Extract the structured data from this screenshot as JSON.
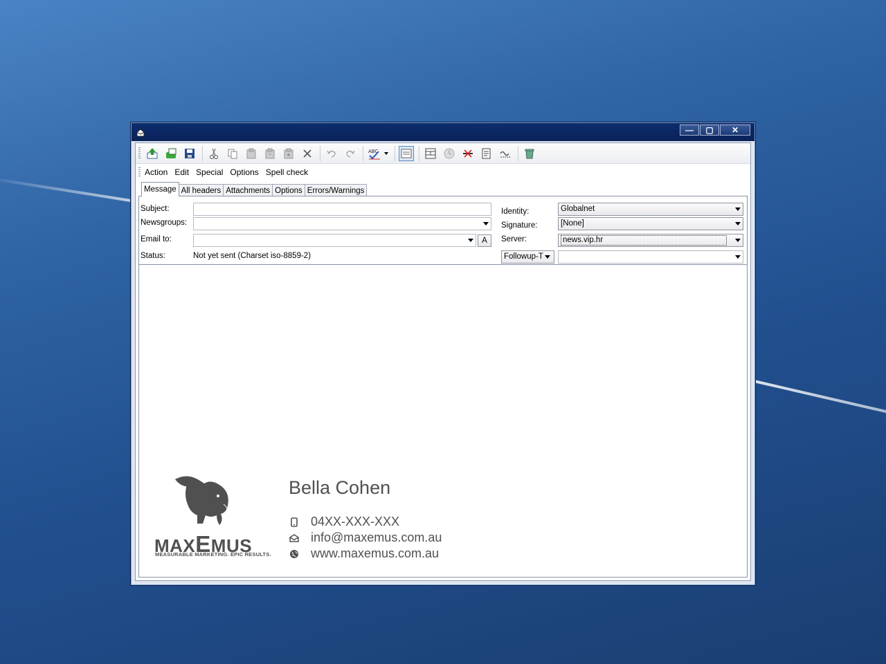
{
  "menu": {
    "items": [
      {
        "label": "Action"
      },
      {
        "label": "Edit"
      },
      {
        "label": "Special"
      },
      {
        "label": "Options"
      },
      {
        "label": "Spell check"
      }
    ]
  },
  "tabs": [
    {
      "label": "Message",
      "active": true
    },
    {
      "label": "All headers"
    },
    {
      "label": "Attachments"
    },
    {
      "label": "Options"
    },
    {
      "label": "Errors/Warnings"
    }
  ],
  "form": {
    "subject_label": "Subject:",
    "subject_value": "",
    "newsgroups_label": "Newsgroups:",
    "newsgroups_value": "",
    "email_to_label": "Email to:",
    "email_to_value": "",
    "address_button": "A",
    "status_label": "Status:",
    "status_value": "Not yet sent (Charset iso-8859-2)",
    "identity_label": "Identity:",
    "identity_value": "Globalnet",
    "signature_label": "Signature:",
    "signature_value": "[None]",
    "server_label": "Server:",
    "server_value": "news.vip.hr",
    "followup_label": "Followup-T",
    "followup_value": ""
  },
  "signature": {
    "name": "Bella Cohen",
    "phone": "04XX-XXX-XXX",
    "email": "info@maxemus.com.au",
    "website": "www.maxemus.com.au",
    "logo_text_a": "MAX",
    "logo_text_b": "E",
    "logo_text_c": "MUS",
    "tagline": "MEASURABLE MARKETING. EPIC RESULTS.",
    "text_color": "#505050"
  },
  "colors": {
    "titlebar": "#0c2d6e",
    "desktop": "#2f63a3"
  }
}
